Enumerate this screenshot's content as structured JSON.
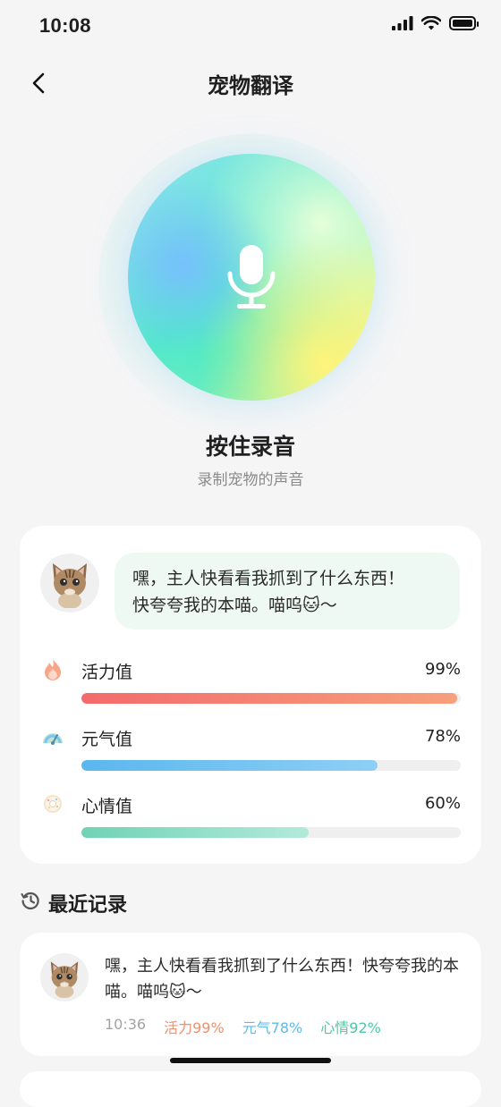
{
  "status_bar": {
    "time": "10:08"
  },
  "nav": {
    "title": "宠物翻译"
  },
  "recorder": {
    "title": "按住录音",
    "subtitle": "录制宠物的声音"
  },
  "translation": {
    "line1": "嘿，主人快看看我抓到了什么东西！",
    "line2": "快夸夸我的本喵。喵呜🐱～"
  },
  "metrics": [
    {
      "label": "活力值",
      "value": "99%",
      "fraction": 0.99,
      "icon": "flame-icon",
      "color_start": "#f36b6b",
      "color_end": "#f6a07c"
    },
    {
      "label": "元气值",
      "value": "78%",
      "fraction": 0.78,
      "icon": "energy-gauge-icon",
      "color_start": "#5bb7ef",
      "color_end": "#8ecff5"
    },
    {
      "label": "心情值",
      "value": "60%",
      "fraction": 0.6,
      "icon": "mood-donut-icon",
      "color_start": "#6fd3b5",
      "color_end": "#b3ead9"
    }
  ],
  "history": {
    "title": "最近记录",
    "records": [
      {
        "text": "嘿，主人快看看我抓到了什么东西！快夸夸我的本喵。喵呜🐱～",
        "time": "10:36",
        "vitality": "活力99%",
        "energy": "元气78%",
        "mood": "心情92%"
      }
    ]
  },
  "colors": {
    "vitality": "#f0916a",
    "energy": "#5fb9ec",
    "mood": "#4fc7a6"
  }
}
